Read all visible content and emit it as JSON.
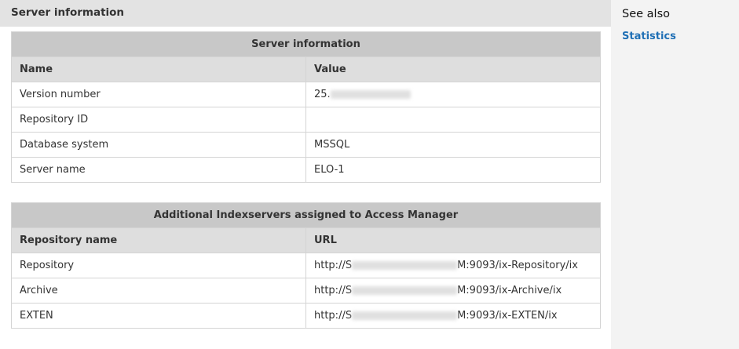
{
  "header": {
    "title": "Server information"
  },
  "sidebar": {
    "heading": "See also",
    "links": [
      {
        "label": "Statistics"
      }
    ]
  },
  "server_table": {
    "caption": "Server information",
    "columns": [
      "Name",
      "Value"
    ],
    "rows": [
      {
        "name": "Version number",
        "value": "25."
      },
      {
        "name": "Repository ID",
        "value": ""
      },
      {
        "name": "Database system",
        "value": "MSSQL"
      },
      {
        "name": "Server name",
        "value": "ELO-1"
      }
    ]
  },
  "indexserver_table": {
    "caption": "Additional Indexservers assigned to Access Manager",
    "columns": [
      "Repository name",
      "URL"
    ],
    "rows": [
      {
        "name": "Repository",
        "url_prefix": "http://S",
        "url_suffix": "M:9093/ix-Repository/ix"
      },
      {
        "name": "Archive",
        "url_prefix": "http://S",
        "url_suffix": "M:9093/ix-Archive/ix"
      },
      {
        "name": "EXTEN",
        "url_prefix": "http://S",
        "url_suffix": "M:9093/ix-EXTEN/ix"
      }
    ]
  }
}
